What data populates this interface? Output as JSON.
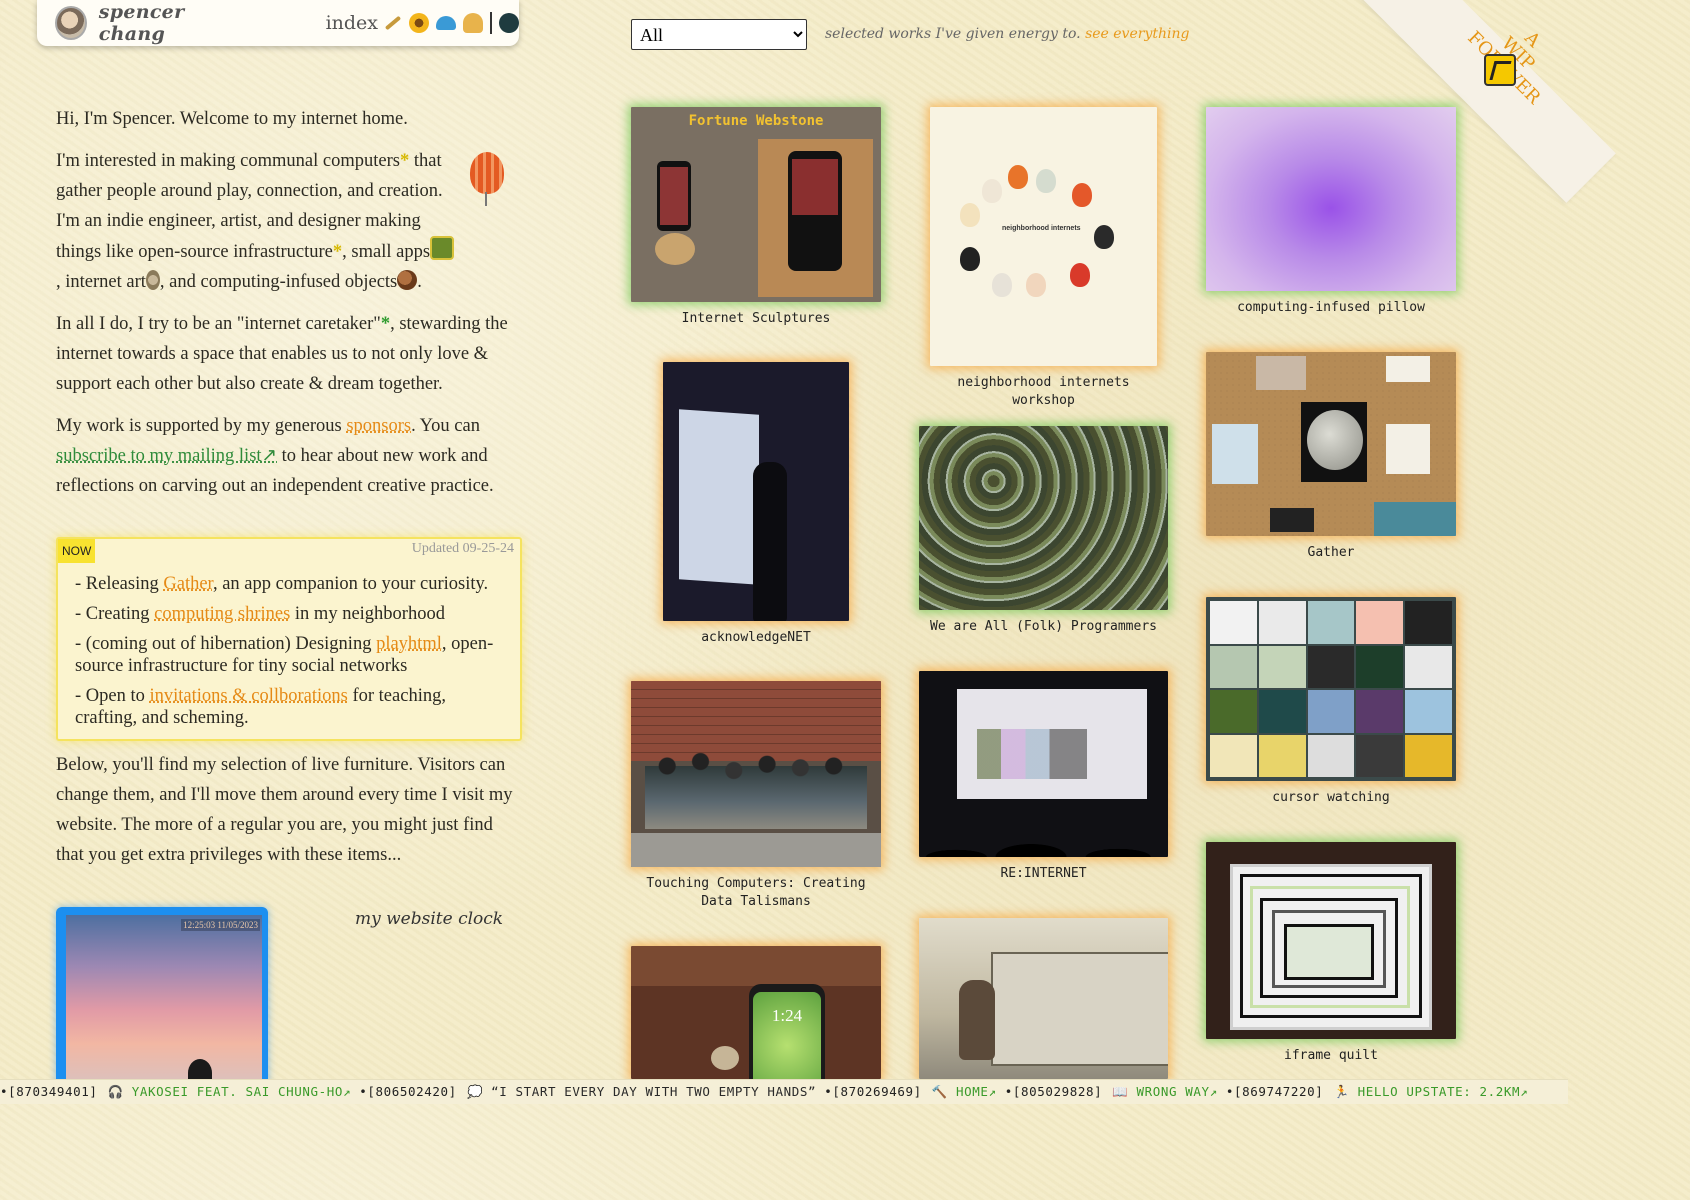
{
  "header": {
    "site_name": "spencer chang",
    "nav_index": "index"
  },
  "intro": {
    "greeting": "Hi, I'm Spencer. Welcome to my internet home.",
    "p2_a": "I'm interested in making communal computers",
    "p2_b": " that gather people around play, connection, and creation. I'm an indie engineer, artist, and designer making things like open-source infrastructure",
    "p2_c": ", small apps",
    "p2_d": ", internet art",
    "p2_e": ", and computing-infused objects",
    "p2_f": ".",
    "star": "*",
    "p3_a": "In all I do, I try to be an \"internet caretaker\"",
    "p3_b": ", stewarding the internet towards a space that enables us to not only love & support each other but also create & dream together.",
    "p4_a": "My work is supported by my generous ",
    "p4_sponsors": "sponsors",
    "p4_b": ". You can ",
    "p4_subscribe": "subscribe to my mailing list↗",
    "p4_c": " to hear about new work and reflections on carving out an independent creative practice."
  },
  "now": {
    "tag": "NOW",
    "updated": "Updated 09-25-24",
    "i1_a": "- Releasing ",
    "i1_link": "Gather",
    "i1_b": ", an app companion to your curiosity.",
    "i2_a": "- Creating ",
    "i2_link": "computing shrines",
    "i2_b": " in my neighborhood",
    "i3_a": "- (coming out of hibernation) Designing ",
    "i3_link": "playhtml",
    "i3_b": ", open-source infrastructure for tiny social networks",
    "i4_a": "- Open to ",
    "i4_link": "invitations & collborations",
    "i4_b": " for teaching, crafting, and scheming."
  },
  "below": {
    "text": "Below, you'll find my selection of live furniture. Visitors can change them, and I'll move them around every time I visit my website. The more of a regular you are, you might just find that you get extra privileges with these items..."
  },
  "clock": {
    "label": "my website clock",
    "timestamp": "12:25:03 11/05/2023"
  },
  "filter": {
    "selected": "All",
    "options": [
      "All"
    ],
    "caption": "selected works I've given energy to. ",
    "see_everything": "see everything"
  },
  "ribbon": {
    "line1": "A",
    "line2": "WIP",
    "line3": "FOREVER"
  },
  "works": {
    "w1": {
      "title": "Internet Sculptures",
      "thumb_title": "Fortune Webstone",
      "glow": "green"
    },
    "w2": {
      "title": "neighborhood internets workshop",
      "thumb_text": "neighborhood internets",
      "glow": "orange"
    },
    "w3": {
      "title": "computing-infused pillow",
      "glow": "green"
    },
    "w4": {
      "title": "acknowledgeNET",
      "glow": "orange"
    },
    "w5": {
      "title": "We are All (Folk) Programmers",
      "glow": "green"
    },
    "w6": {
      "title": "Gather",
      "glow": "orange"
    },
    "w7": {
      "title": "cursor watching",
      "glow": "orange"
    },
    "w8": {
      "title": "Touching Computers: Creating Data Talismans",
      "glow": "orange"
    },
    "w9": {
      "title": "RE:INTERNET",
      "glow": "orange"
    },
    "w10": {
      "title": "iframe quilt",
      "glow": "green"
    },
    "w11": {
      "title": "",
      "phone_time": "1:24",
      "glow": "orange"
    },
    "w12": {
      "title": "",
      "glow": "orange"
    }
  },
  "ticker": {
    "items": [
      {
        "id": "•[870349401]",
        "icon": "headphones-icon",
        "glyph": "🎧",
        "text": "YAKOSEI FEAT. SAI CHUNG-HO↗",
        "link": true
      },
      {
        "id": "•[806502420]",
        "icon": "speech-bubble-icon",
        "glyph": "💭",
        "text": "“I START EVERY DAY WITH TWO EMPTY HANDS”",
        "link": false
      },
      {
        "id": "•[870269469]",
        "icon": "hammer-icon",
        "glyph": "🔨",
        "text": "HOME↗",
        "link": true
      },
      {
        "id": "•[805029828]",
        "icon": "book-icon",
        "glyph": "📖",
        "text": "WRONG WAY↗",
        "link": true
      },
      {
        "id": "•[869747220]",
        "icon": "runner-icon",
        "glyph": "🏃",
        "text": "HELLO UPSTATE: 2.2KM↗",
        "link": true
      }
    ]
  },
  "colors": {
    "background": "#f4ecc8",
    "link_orange": "#e58a16",
    "link_green": "#2f8b3a",
    "now_highlight": "#f8e230",
    "clock_frame": "#1c8ff0"
  }
}
